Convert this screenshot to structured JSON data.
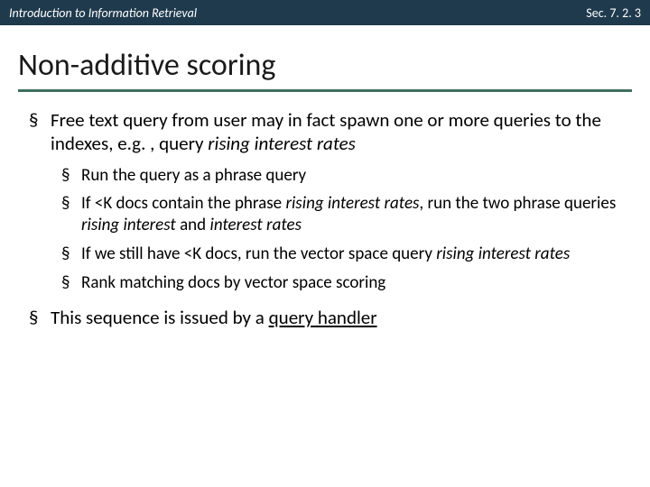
{
  "topbar": {
    "left": "Introduction to Information Retrieval",
    "right": "Sec. 7. 2. 3"
  },
  "title": "Non-additive scoring",
  "bullets": {
    "b1_pre": "Free text query from user may in fact spawn one or more queries to the indexes, e.g. , query ",
    "b1_ital": "rising interest rates",
    "sub1": "Run the query as a phrase query",
    "sub2_a": "If <K docs contain the phrase ",
    "sub2_b": "rising interest rates",
    "sub2_c": ", run the two phrase queries ",
    "sub2_d": "rising interest",
    "sub2_e": " and ",
    "sub2_f": "interest rates",
    "sub3_a": "If we still have <K docs, run the vector space query ",
    "sub3_b": "rising interest rates",
    "sub4": "Rank matching docs by vector space scoring",
    "b2_pre": "This sequence is issued by a ",
    "b2_u": "query handler"
  }
}
